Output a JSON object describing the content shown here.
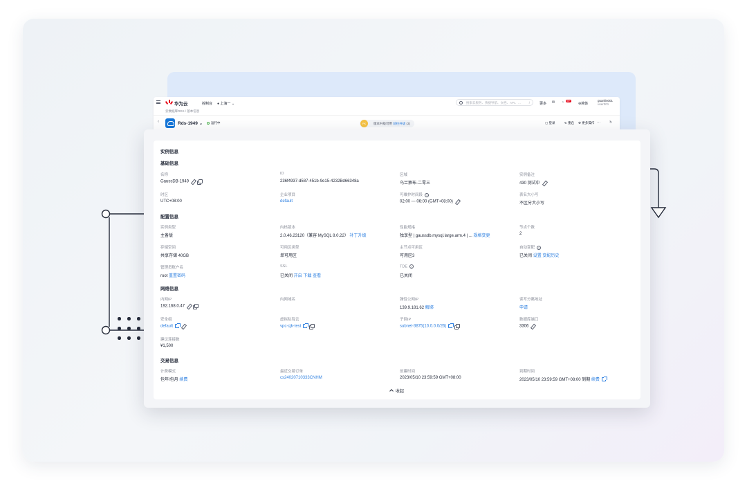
{
  "console": {
    "brand": "华为云",
    "nav": {
      "console": "控制台",
      "region": "上海一"
    },
    "search_placeholder": "搜索云服务、快捷导航、文档、API、…",
    "shortcut_hint": "/",
    "header_links": {
      "more": "更多",
      "lang": "简体"
    },
    "notification_count": "99+",
    "user": {
      "name": "guanlin001",
      "sub": "user001"
    },
    "breadcrumb": "云数据库RDS / 基本信息",
    "instance_name": "Rds-1949",
    "instance_status": "运行中",
    "upgrade_text": "版本升级可用",
    "upgrade_link": "前往升级",
    "upgrade_count": "(3)",
    "actions": [
      "登录",
      "重启",
      "更多操作"
    ],
    "coin_label": "PK"
  },
  "detail": {
    "title": "实例信息",
    "collapse_label": "收起",
    "sections": {
      "basic": {
        "title": "基础信息",
        "items": [
          {
            "label": "名称",
            "value": "GaussDB-1949"
          },
          {
            "label": "ID",
            "value": "236f4937-d587-451b-9e15-4232Bd66348a"
          },
          {
            "label": "区域",
            "value": "乌兰察布-二零三"
          },
          {
            "label": "实例备注",
            "value": "430 测试中"
          },
          {
            "label": "时区",
            "value": "UTC+08:00"
          },
          {
            "label": "企业项目",
            "value": "default"
          },
          {
            "label": "可维护时间段",
            "value": "02:00 — 06:00 (GMT+08:00)"
          },
          {
            "label": "表名大小写",
            "value": "不区分大小写"
          }
        ]
      },
      "config": {
        "title": "配置信息",
        "items": [
          {
            "label": "实例类型",
            "value": "主备版"
          },
          {
            "label": "内核版本",
            "value": "2.0.46.23120（兼容 MySQL 8.0.22）",
            "link": "补丁升级"
          },
          {
            "label": "性能规格",
            "value": "独享型 | gaussdb.mysql.large.arm.4 | ...",
            "link": "规格变更"
          },
          {
            "label": "节点个数",
            "value": "2"
          },
          {
            "label": "存储空间",
            "value": "共享存储 40GB"
          },
          {
            "label": "可用区类型",
            "value": "单可用区"
          },
          {
            "label": "主节点可用区",
            "value": "可用区3"
          },
          {
            "label": "自动变配",
            "value": "已关闭",
            "links": [
              "设置",
              "变配历史"
            ]
          },
          {
            "label": "管理员账户名",
            "value": "root",
            "link": "重置密码"
          },
          {
            "label": "SSL",
            "value": "已关闭",
            "links": [
              "开启",
              "下载",
              "查看"
            ]
          },
          {
            "label": "TDE",
            "value": "已关闭"
          }
        ]
      },
      "network": {
        "title": "网络信息",
        "items": [
          {
            "label": "内网IP",
            "value": "192.168.0.47"
          },
          {
            "label": "内网域名",
            "value": ""
          },
          {
            "label": "弹性公网IP",
            "value": "139.9.181.62",
            "link": "解绑"
          },
          {
            "label": "读写分离地址",
            "link": "申请"
          },
          {
            "label": "安全组",
            "link": "default"
          },
          {
            "label": "虚拟私有云",
            "link": "vpc-cjk-test"
          },
          {
            "label": "子网IP",
            "link": "subnet-3875(10.0.0.0/26)"
          },
          {
            "label": "数据库端口",
            "value": "3306"
          },
          {
            "label": "建议连接数",
            "value": "¥1,500"
          }
        ]
      },
      "billing": {
        "title": "交易信息",
        "items": [
          {
            "label": "计费模式",
            "value": "包年/包月",
            "link": "续费"
          },
          {
            "label": "最近交易订单",
            "link": "cs24020710333CNHM"
          },
          {
            "label": "创建时间",
            "value": "2023/05/10 23:59:59 GMT+08:00"
          },
          {
            "label": "到期时间",
            "value": "2023/05/10 23:59:59 GMT+08:00 到期",
            "link": "续费"
          }
        ]
      }
    }
  },
  "colors": {
    "accent": "#2c7fe0",
    "brand_red": "#e60012",
    "status_green": "#50b450"
  }
}
